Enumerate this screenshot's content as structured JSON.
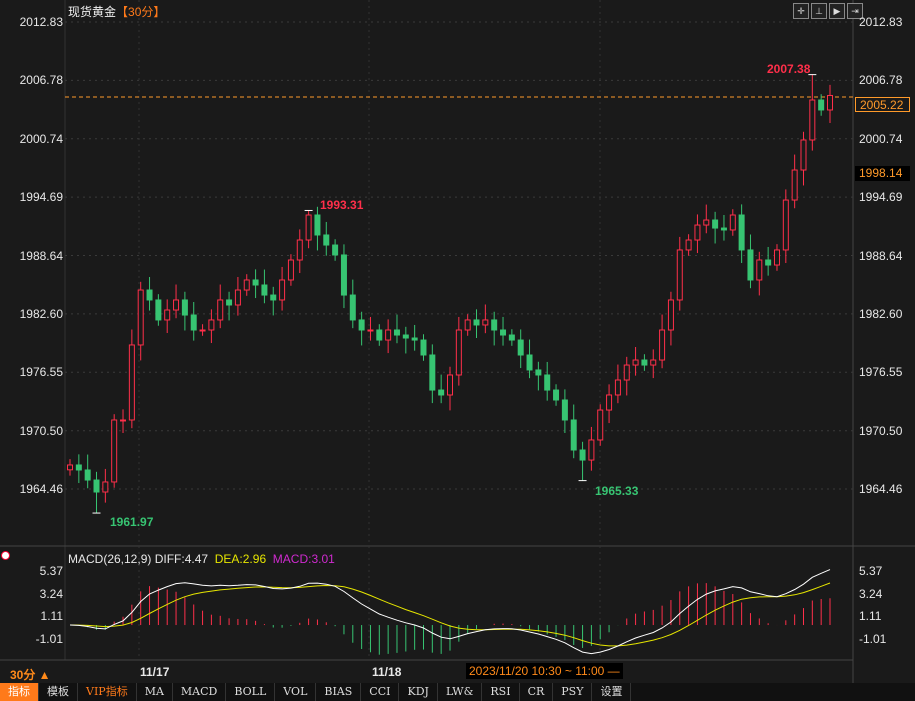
{
  "header": {
    "instrument": "现货黄金",
    "period": "【30分】"
  },
  "toolbar_icons": [
    "crosshair-icon",
    "zoom-in-icon",
    "play-icon",
    "exit-icon"
  ],
  "price_axis": [
    "2012.83",
    "2006.78",
    "2000.74",
    "1994.69",
    "1988.64",
    "1982.60",
    "1976.55",
    "1970.50",
    "1964.46"
  ],
  "current_price": "2005.22",
  "reference_price": "1998.14",
  "annotations": {
    "low1": "1961.97",
    "high1": "1993.31",
    "low2": "1965.33",
    "high2": "2007.38"
  },
  "macd": {
    "label": "MACD(26,12,9)",
    "diff": "DIFF:4.47",
    "dea": "DEA:2.96",
    "macd": "MACD:3.01",
    "axis": [
      "5.37",
      "3.24",
      "1.11",
      "-1.01"
    ]
  },
  "dates": [
    "11/17",
    "11/18"
  ],
  "period_selector": "30分 ▲",
  "cursor_label": "2023/11/20 10:30 ~ 11:00 —",
  "tabs": [
    "指标",
    "模板",
    "VIP指标",
    "MA",
    "MACD",
    "BOLL",
    "VOL",
    "BIAS",
    "CCI",
    "KDJ",
    "LW&",
    "RSI",
    "CR",
    "PSY",
    "设置"
  ],
  "colors": {
    "up": "#ff2f4a",
    "down": "#37c472",
    "diff": "#ffffff",
    "dea": "#e6e600",
    "accent": "#ff7a1a"
  },
  "chart_data": {
    "type": "candlestick",
    "title": "现货黄金 30分",
    "ylim": [
      1960.5,
      2013.5
    ],
    "closes": [
      1966.95,
      1966.43,
      1965.39,
      1964.15,
      1965.19,
      1971.61,
      1971.61,
      1979.38,
      1985.07,
      1984.04,
      1981.97,
      1983.0,
      1984.04,
      1982.48,
      1980.93,
      1980.93,
      1981.97,
      1984.04,
      1983.52,
      1985.07,
      1986.11,
      1985.59,
      1984.55,
      1984.04,
      1986.11,
      1988.18,
      1990.25,
      1992.84,
      1990.77,
      1989.73,
      1988.7,
      1984.55,
      1981.97,
      1980.93,
      1980.93,
      1979.89,
      1980.93,
      1980.41,
      1980.1,
      1979.89,
      1978.34,
      1974.71,
      1974.2,
      1976.27,
      1980.93,
      1981.97,
      1981.45,
      1981.97,
      1980.93,
      1980.41,
      1979.89,
      1978.34,
      1976.79,
      1976.27,
      1974.71,
      1973.68,
      1971.61,
      1968.5,
      1967.46,
      1969.54,
      1972.64,
      1974.2,
      1975.75,
      1977.3,
      1977.82,
      1977.3,
      1977.82,
      1980.93,
      1984.04,
      1989.22,
      1990.25,
      1991.8,
      1992.32,
      1991.49,
      1991.29,
      1992.84,
      1989.22,
      1986.11,
      1988.18,
      1987.66,
      1989.22,
      1994.39,
      1997.5,
      2000.61,
      2004.75,
      2003.72,
      2005.22
    ],
    "extremes": [
      {
        "index": 3,
        "low": 1961.97
      },
      {
        "index": 27,
        "high": 1993.31
      },
      {
        "index": 58,
        "low": 1965.33
      },
      {
        "index": 84,
        "high": 2007.38
      }
    ]
  }
}
